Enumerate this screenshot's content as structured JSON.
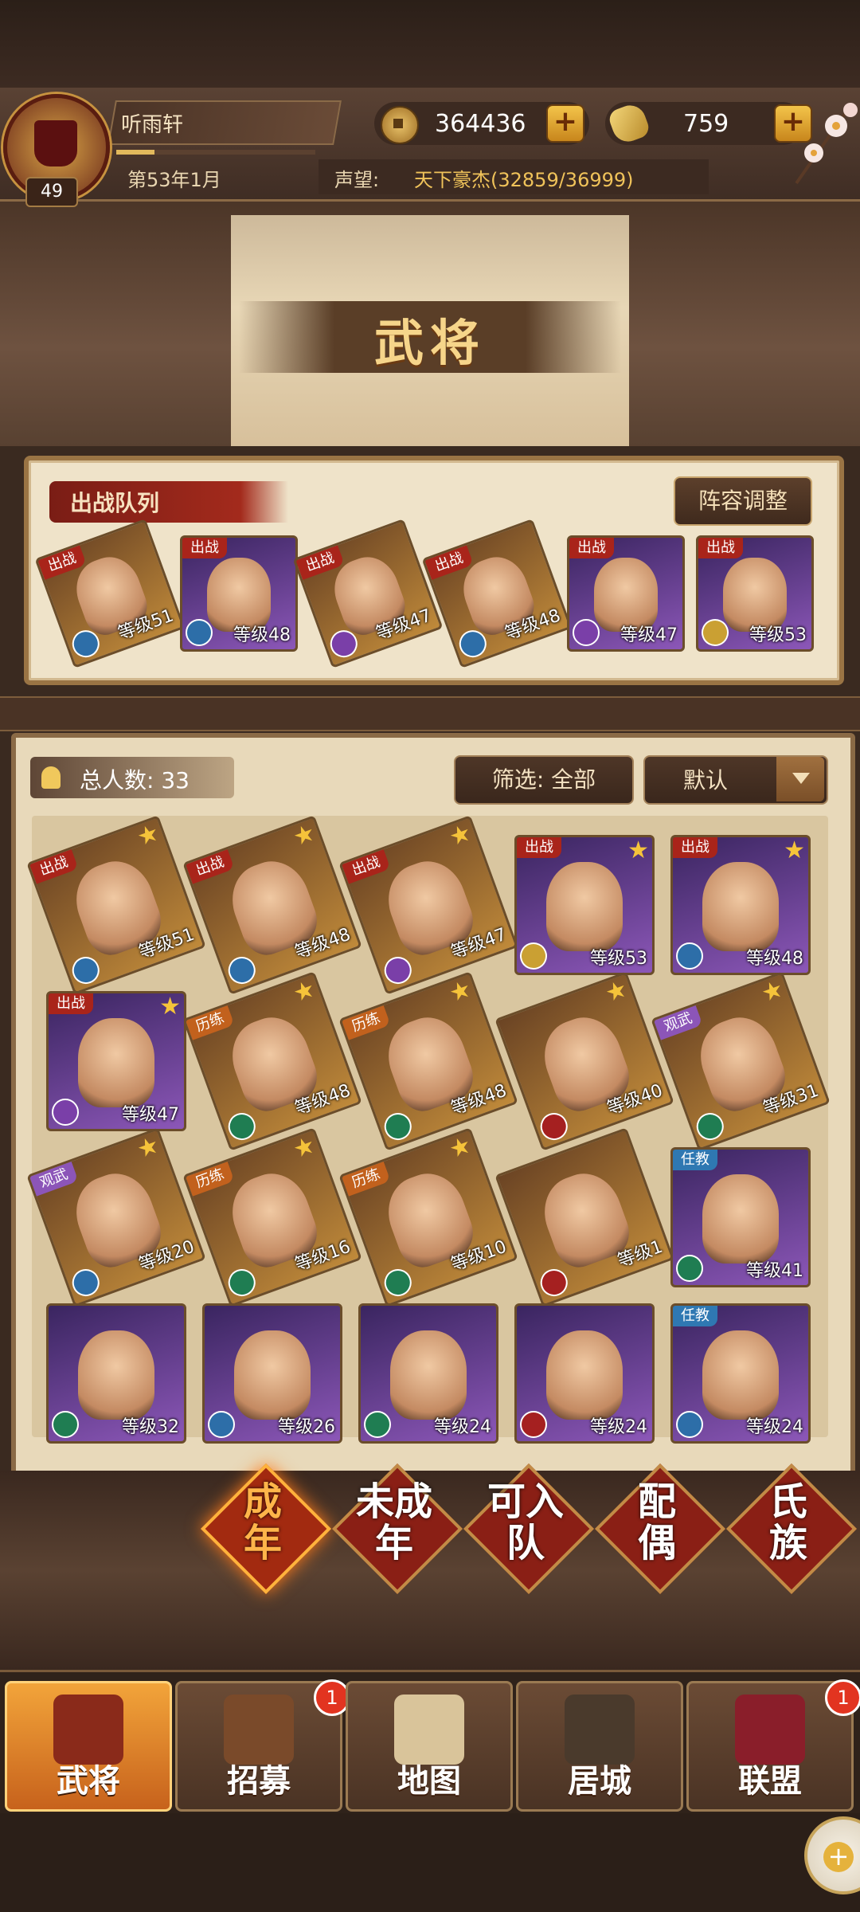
{
  "header": {
    "player_name": "听雨轩",
    "player_level": "49",
    "date": "第53年1月",
    "prestige_label": "声望:",
    "prestige_value": "天下豪杰(32859/36999)",
    "copper": "364436",
    "gold": "759",
    "add_symbol": "+"
  },
  "page": {
    "title": "武将"
  },
  "team": {
    "label": "出战队列",
    "lineup_button": "阵容调整",
    "members": [
      {
        "tag": "出战",
        "level": "等级51",
        "frame": "gold",
        "icon": "blue"
      },
      {
        "tag": "出战",
        "level": "等级48",
        "frame": "purple",
        "icon": "blue"
      },
      {
        "tag": "出战",
        "level": "等级47",
        "frame": "gold",
        "icon": "purple"
      },
      {
        "tag": "出战",
        "level": "等级48",
        "frame": "gold",
        "icon": "blue"
      },
      {
        "tag": "出战",
        "level": "等级47",
        "frame": "purple",
        "icon": "purple"
      },
      {
        "tag": "出战",
        "level": "等级53",
        "frame": "purple",
        "icon": "gold"
      }
    ]
  },
  "roster": {
    "total_label": "总人数: 33",
    "filter_label": "筛选: 全部",
    "sort_label": "默认",
    "generals": [
      {
        "tag": "出战",
        "tag_color": "red",
        "star": true,
        "level": "等级51",
        "frame": "gold",
        "icon": "blue"
      },
      {
        "tag": "出战",
        "tag_color": "red",
        "star": true,
        "level": "等级48",
        "frame": "gold",
        "icon": "blue"
      },
      {
        "tag": "出战",
        "tag_color": "red",
        "star": true,
        "level": "等级47",
        "frame": "gold",
        "icon": "purple"
      },
      {
        "tag": "出战",
        "tag_color": "red",
        "star": true,
        "level": "等级53",
        "frame": "purple",
        "icon": "gold"
      },
      {
        "tag": "出战",
        "tag_color": "red",
        "star": true,
        "level": "等级48",
        "frame": "purple",
        "icon": "blue"
      },
      {
        "tag": "出战",
        "tag_color": "red",
        "star": true,
        "level": "等级47",
        "frame": "purple",
        "icon": "purple"
      },
      {
        "tag": "历练",
        "tag_color": "orange",
        "star": true,
        "level": "等级48",
        "frame": "gold",
        "icon": "green"
      },
      {
        "tag": "历练",
        "tag_color": "orange",
        "star": true,
        "level": "等级48",
        "frame": "gold",
        "icon": "green"
      },
      {
        "tag": "",
        "tag_color": "",
        "star": true,
        "level": "等级40",
        "frame": "gold",
        "icon": "red"
      },
      {
        "tag": "观武",
        "tag_color": "violet",
        "star": true,
        "level": "等级31",
        "frame": "gold",
        "icon": "green"
      },
      {
        "tag": "观武",
        "tag_color": "violet",
        "star": true,
        "level": "等级20",
        "frame": "gold",
        "icon": "blue"
      },
      {
        "tag": "历练",
        "tag_color": "orange",
        "star": true,
        "level": "等级16",
        "frame": "gold",
        "icon": "green"
      },
      {
        "tag": "历练",
        "tag_color": "orange",
        "star": true,
        "level": "等级10",
        "frame": "gold",
        "icon": "green"
      },
      {
        "tag": "",
        "tag_color": "",
        "star": false,
        "level": "等级1",
        "frame": "gold",
        "icon": "red"
      },
      {
        "tag": "任教",
        "tag_color": "blue",
        "star": false,
        "level": "等级41",
        "frame": "purple",
        "icon": "green"
      },
      {
        "tag": "",
        "tag_color": "",
        "star": false,
        "level": "等级32",
        "frame": "purple",
        "icon": "green"
      },
      {
        "tag": "",
        "tag_color": "",
        "star": false,
        "level": "等级26",
        "frame": "purple",
        "icon": "blue"
      },
      {
        "tag": "",
        "tag_color": "",
        "star": false,
        "level": "等级24",
        "frame": "purple",
        "icon": "green"
      },
      {
        "tag": "",
        "tag_color": "",
        "star": false,
        "level": "等级24",
        "frame": "purple",
        "icon": "red"
      },
      {
        "tag": "任教",
        "tag_color": "blue",
        "star": false,
        "level": "等级24",
        "frame": "purple",
        "icon": "blue"
      }
    ]
  },
  "category_tabs": [
    {
      "line1": "成",
      "line2": "年",
      "active": true
    },
    {
      "line1": "未成",
      "line2": "年",
      "active": false
    },
    {
      "line1": "可入",
      "line2": "队",
      "active": false
    },
    {
      "line1": "配",
      "line2": "偶",
      "active": false
    },
    {
      "line1": "氏",
      "line2": "族",
      "active": false
    }
  ],
  "nav": [
    {
      "label": "武将",
      "active": true,
      "badge": ""
    },
    {
      "label": "招募",
      "active": false,
      "badge": "1"
    },
    {
      "label": "地图",
      "active": false,
      "badge": ""
    },
    {
      "label": "居城",
      "active": false,
      "badge": ""
    },
    {
      "label": "联盟",
      "active": false,
      "badge": "1"
    }
  ]
}
